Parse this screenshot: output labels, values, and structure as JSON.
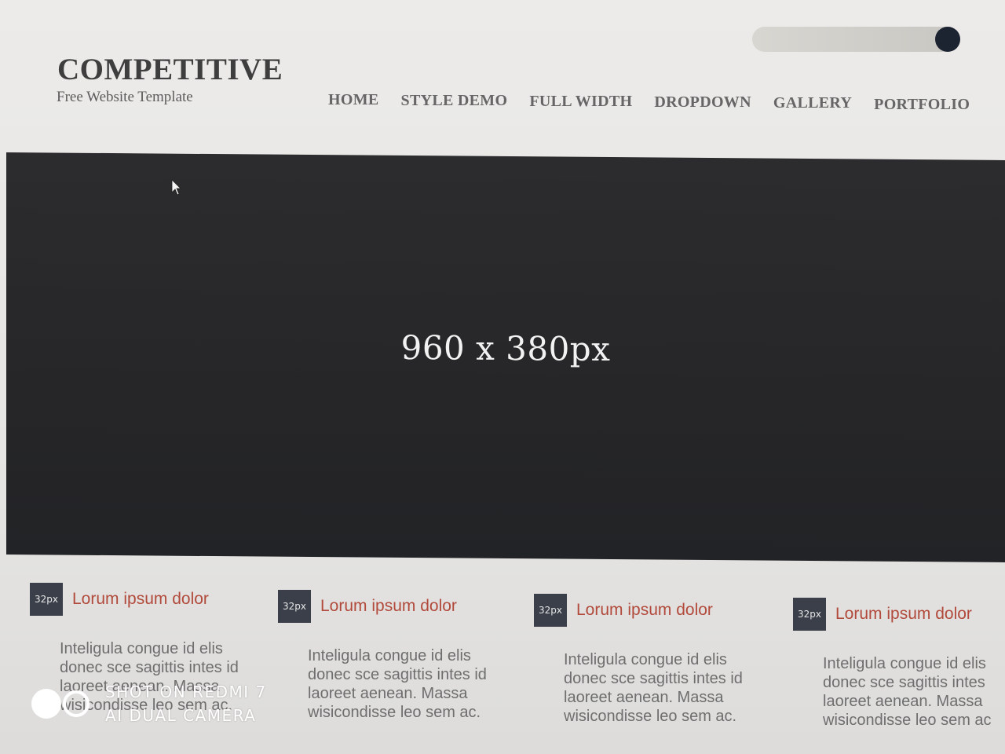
{
  "header": {
    "logo_title": "COMPETITIVE",
    "logo_subtitle": "Free Website Template"
  },
  "nav": {
    "items": [
      {
        "label": "HOME"
      },
      {
        "label": "STYLE DEMO"
      },
      {
        "label": "FULL WIDTH"
      },
      {
        "label": "DROPDOWN"
      },
      {
        "label": "GALLERY"
      },
      {
        "label": "PORTFOLIO"
      }
    ]
  },
  "hero": {
    "placeholder_text": "960 x 380px"
  },
  "features": [
    {
      "icon_text": "32px",
      "title": "Lorum ipsum dolor",
      "body": "Inteligula congue id elis donec sce sagittis intes id laoreet aenean. Massa wisicondisse leo sem ac."
    },
    {
      "icon_text": "32px",
      "title": "Lorum ipsum dolor",
      "body": "Inteligula congue id elis donec sce sagittis intes id laoreet aenean. Massa wisicondisse leo sem ac."
    },
    {
      "icon_text": "32px",
      "title": "Lorum ipsum dolor",
      "body": "Inteligula congue id elis donec sce sagittis intes id laoreet aenean. Massa wisicondisse leo sem ac."
    },
    {
      "icon_text": "32px",
      "title": "Lorum ipsum dolor",
      "body": "Inteligula congue id elis donec sce sagittis intes laoreet aenean. Massa wisicondisse leo sem ac"
    }
  ],
  "watermark": {
    "line1": "SHOT ON REDMI 7",
    "line2": "AI DUAL CAMERA"
  },
  "colors": {
    "accent": "#b24a3c",
    "hero_bg": "#262628",
    "search_button": "#1c2331"
  }
}
